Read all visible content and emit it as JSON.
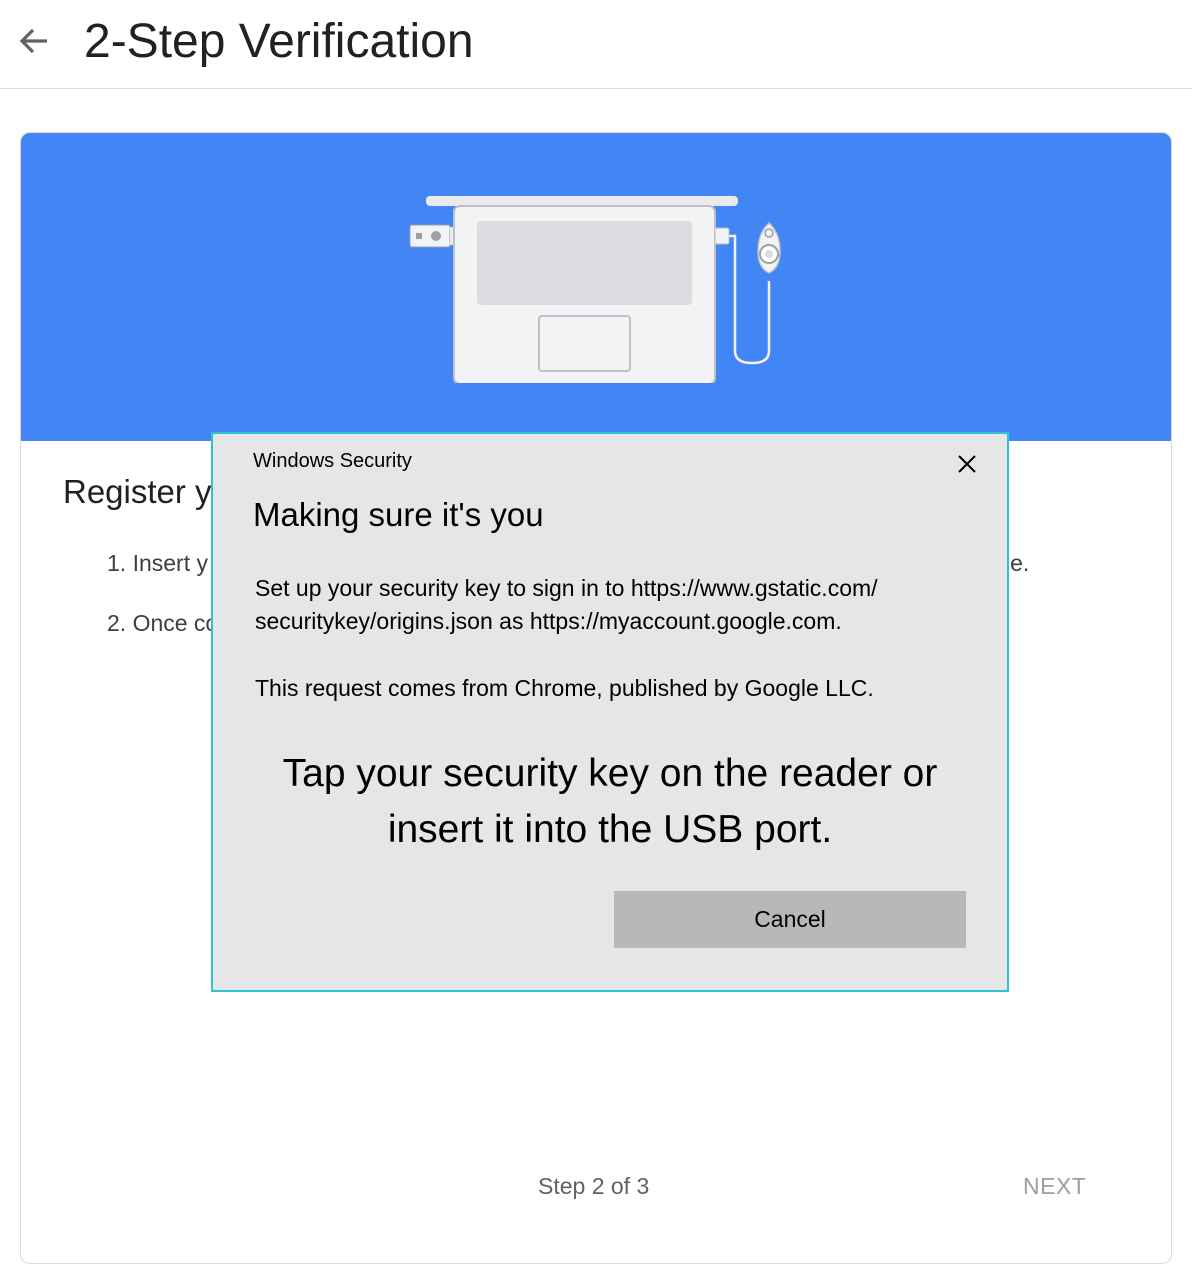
{
  "header": {
    "title": "2-Step Verification",
    "back_icon": "arrow-back-icon"
  },
  "card": {
    "illustration": "laptop-security-key-illustration",
    "heading": "Register y",
    "steps": [
      {
        "text": "1. Insert y"
      },
      {
        "text": "2. Once co"
      }
    ],
    "step1_tail": "le.",
    "step_count": "Step 2 of 3",
    "next_label": "NEXT"
  },
  "dialog": {
    "app_name": "Windows Security",
    "close_icon": "close-icon",
    "title": "Making sure it's you",
    "body_line1": "Set up your security key to sign in to https://www.gstatic.com/",
    "body_line2": "securitykey/origins.json as https://myaccount.google.com.",
    "request_text": "This request comes from Chrome, published by Google LLC.",
    "prompt_line1": "Tap your security key on the reader or",
    "prompt_line2": "insert it into the USB port.",
    "cancel_label": "Cancel"
  },
  "colors": {
    "banner": "#4285f4",
    "dialog_bg": "#e6e6e6",
    "dialog_border": "#2bc4d4",
    "cancel_button": "#b8b8b8"
  }
}
